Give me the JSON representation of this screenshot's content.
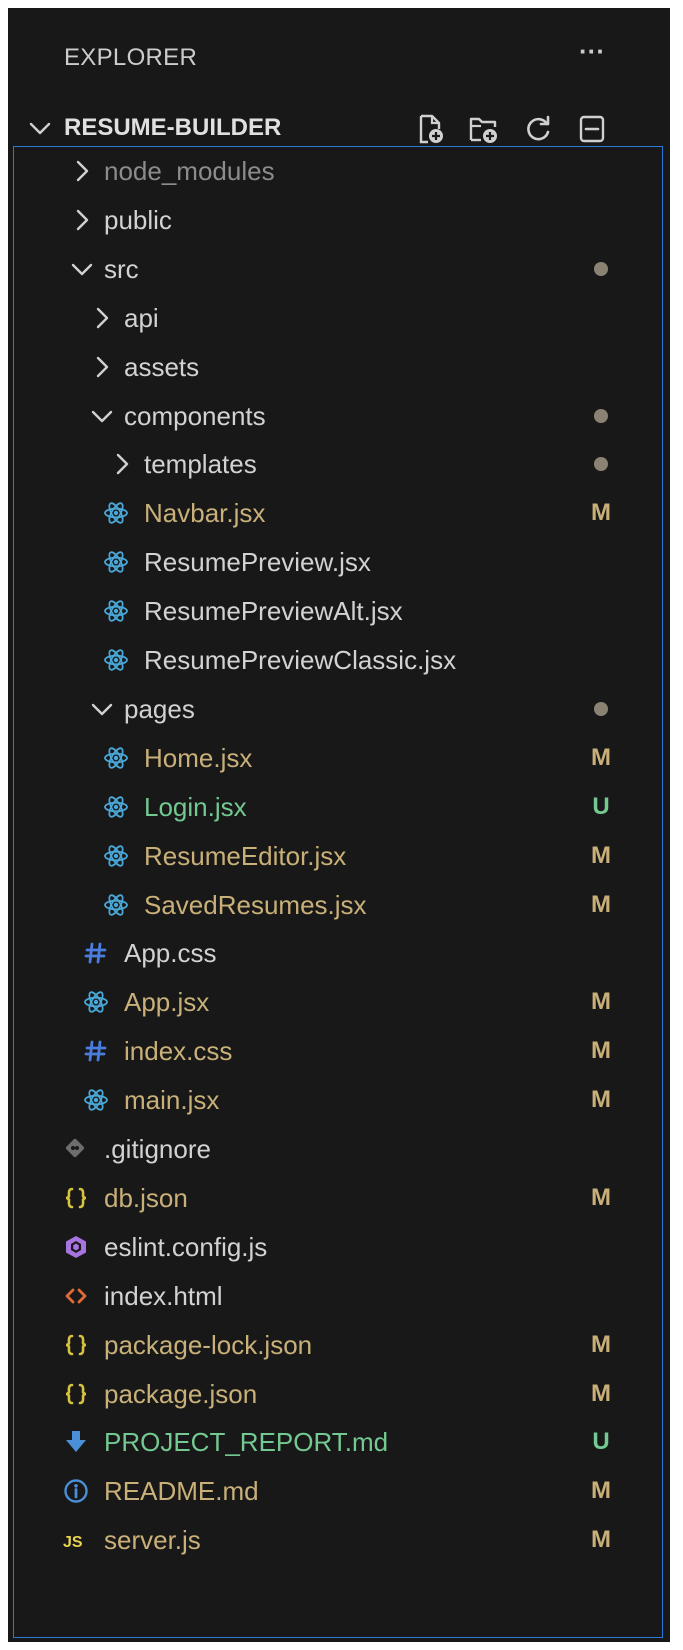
{
  "explorer": {
    "title": "EXPLORER",
    "more": "···"
  },
  "section": {
    "title": "RESUME-BUILDER",
    "toolbar": [
      "new-file-icon",
      "new-folder-icon",
      "refresh-icon",
      "collapse-all-icon"
    ]
  },
  "colors": {
    "modified": "#c9b079",
    "untracked": "#73c991",
    "ignored": "#8c8c8c",
    "folder": "#d2d2d2",
    "react_icon": "#4aa8d8",
    "css_icon": "#4a7dde",
    "json_icon": "#d6c23e",
    "eslint_icon": "#a874e0",
    "html_icon": "#e26b3a",
    "md_icon": "#4b8fd8",
    "info_icon": "#4b8fd8",
    "js_icon": "#e8d44d",
    "git_icon": "#6d6d6d",
    "focus_border": "#2b79d6"
  },
  "tree": [
    {
      "label": "node_modules",
      "depth": 1,
      "type": "folder",
      "expanded": false,
      "status": "ignored"
    },
    {
      "label": "public",
      "depth": 1,
      "type": "folder",
      "expanded": false
    },
    {
      "label": "src",
      "depth": 1,
      "type": "folder",
      "expanded": true,
      "dot": true
    },
    {
      "label": "api",
      "depth": 2,
      "type": "folder",
      "expanded": false
    },
    {
      "label": "assets",
      "depth": 2,
      "type": "folder",
      "expanded": false
    },
    {
      "label": "components",
      "depth": 2,
      "type": "folder",
      "expanded": true,
      "dot": true
    },
    {
      "label": "templates",
      "depth": 3,
      "type": "folder",
      "expanded": false,
      "dot": true
    },
    {
      "label": "Navbar.jsx",
      "depth": 3,
      "type": "file",
      "icon": "react-icon",
      "status": "modified",
      "badge": "M"
    },
    {
      "label": "ResumePreview.jsx",
      "depth": 3,
      "type": "file",
      "icon": "react-icon"
    },
    {
      "label": "ResumePreviewAlt.jsx",
      "depth": 3,
      "type": "file",
      "icon": "react-icon"
    },
    {
      "label": "ResumePreviewClassic.jsx",
      "depth": 3,
      "type": "file",
      "icon": "react-icon"
    },
    {
      "label": "pages",
      "depth": 2,
      "type": "folder",
      "expanded": true,
      "dot": true
    },
    {
      "label": "Home.jsx",
      "depth": 3,
      "type": "file",
      "icon": "react-icon",
      "status": "modified",
      "badge": "M"
    },
    {
      "label": "Login.jsx",
      "depth": 3,
      "type": "file",
      "icon": "react-icon",
      "status": "untracked",
      "badge": "U"
    },
    {
      "label": "ResumeEditor.jsx",
      "depth": 3,
      "type": "file",
      "icon": "react-icon",
      "status": "modified",
      "badge": "M"
    },
    {
      "label": "SavedResumes.jsx",
      "depth": 3,
      "type": "file",
      "icon": "react-icon",
      "status": "modified",
      "badge": "M"
    },
    {
      "label": "App.css",
      "depth": 2,
      "type": "file",
      "icon": "css-hash-icon"
    },
    {
      "label": "App.jsx",
      "depth": 2,
      "type": "file",
      "icon": "react-icon",
      "status": "modified",
      "badge": "M"
    },
    {
      "label": "index.css",
      "depth": 2,
      "type": "file",
      "icon": "css-hash-icon",
      "status": "modified",
      "badge": "M"
    },
    {
      "label": "main.jsx",
      "depth": 2,
      "type": "file",
      "icon": "react-icon",
      "status": "modified",
      "badge": "M"
    },
    {
      "label": ".gitignore",
      "depth": 1,
      "type": "file",
      "icon": "git-icon"
    },
    {
      "label": "db.json",
      "depth": 1,
      "type": "file",
      "icon": "json-braces-icon",
      "status": "modified",
      "badge": "M"
    },
    {
      "label": "eslint.config.js",
      "depth": 1,
      "type": "file",
      "icon": "eslint-icon"
    },
    {
      "label": "index.html",
      "depth": 1,
      "type": "file",
      "icon": "html-brackets-icon"
    },
    {
      "label": "package-lock.json",
      "depth": 1,
      "type": "file",
      "icon": "json-braces-icon",
      "status": "modified",
      "badge": "M"
    },
    {
      "label": "package.json",
      "depth": 1,
      "type": "file",
      "icon": "json-braces-icon",
      "status": "modified",
      "badge": "M"
    },
    {
      "label": "PROJECT_REPORT.md",
      "depth": 1,
      "type": "file",
      "icon": "markdown-arrow-icon",
      "status": "untracked",
      "badge": "U"
    },
    {
      "label": "README.md",
      "depth": 1,
      "type": "file",
      "icon": "info-icon",
      "status": "modified",
      "badge": "M"
    },
    {
      "label": "server.js",
      "depth": 1,
      "type": "file",
      "icon": "js-icon",
      "status": "modified",
      "badge": "M"
    }
  ]
}
